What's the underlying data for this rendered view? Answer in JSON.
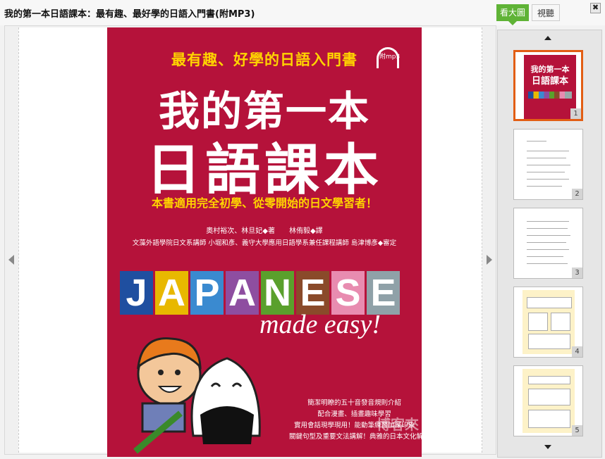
{
  "window": {
    "title": "我的第一本日語課本：最有趣、最好學的日語入門書(附MP3)",
    "close_icon": "✖"
  },
  "viewer": {
    "cover": {
      "subtitle": "最有趣、好學的日語入門書",
      "mp3_label": "附mp3",
      "title_line1": "我的第一本",
      "title_line2": "日語課本",
      "tagline": "本書適用完全初學、從零開始的日文學習者！",
      "authors": "奧村裕次、林旦妃◆著　　林侑毅◆譯",
      "reviewers": "文藻外語學院日文系講師 小堀和彥、義守大學應用日語學系兼任課程講師 島津博彥◆審定",
      "letters": [
        "J",
        "A",
        "P",
        "A",
        "N",
        "E",
        "S",
        "E"
      ],
      "letter_colors": [
        "#1f4fa0",
        "#e8b800",
        "#3a8ad0",
        "#8e4ea0",
        "#5aa02c",
        "#8a4a2a",
        "#e88cb0",
        "#8fa1a8"
      ],
      "tagline_en": "made easy!",
      "bullets": [
        "簡潔明瞭的五十音發音規則介紹",
        "配合漫畫、插畫趣味學習",
        "實用會話現學現用！能動筆練習加深印象",
        "關鍵句型及重要文法講解！典雅的日本文化解說"
      ],
      "watermark": "博客來",
      "colors": {
        "background": "#b5123a",
        "accent": "#ffd400"
      }
    }
  },
  "sidebar": {
    "tabs": [
      {
        "label": "看大圖",
        "active": true
      },
      {
        "label": "視聽",
        "active": false
      }
    ],
    "thumbnails": [
      {
        "page": "1",
        "type": "cover",
        "selected": true,
        "t1": "我的第一本",
        "t2": "日語課本"
      },
      {
        "page": "2",
        "type": "doc",
        "selected": false
      },
      {
        "page": "3",
        "type": "doc",
        "selected": false
      },
      {
        "page": "4",
        "type": "cream",
        "selected": false
      },
      {
        "page": "5",
        "type": "cream",
        "selected": false
      }
    ],
    "colors": {
      "active_tab": "#5fb336",
      "selected_border": "#e25e14"
    }
  }
}
